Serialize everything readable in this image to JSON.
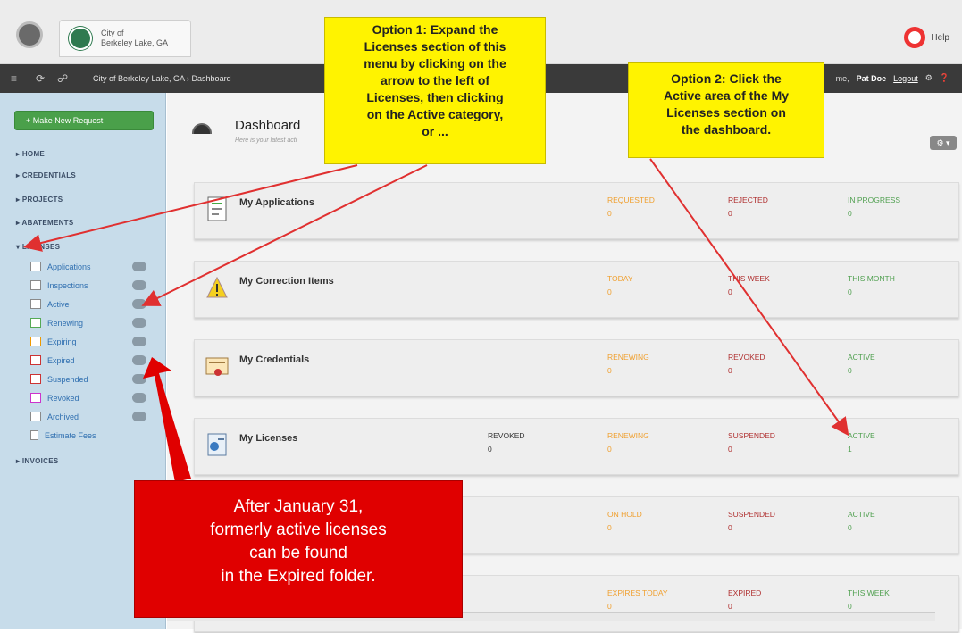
{
  "org": {
    "name_line1": "City of",
    "name_line2": "Berkeley Lake, GA"
  },
  "help_label": "Help",
  "nav": {
    "breadcrumb": "City of Berkeley Lake, GA › Dashboard",
    "welcome_user": "Pat Doe",
    "welcome_prefix": "me,",
    "logout": "Logout"
  },
  "sidebar": {
    "make_request": "+ Make New Request",
    "sections": [
      "HOME",
      "CREDENTIALS",
      "PROJECTS",
      "ABATEMENTS",
      "LICENSES",
      "INVOICES"
    ],
    "license_items": [
      "Applications",
      "Inspections",
      "Active",
      "Renewing",
      "Expiring",
      "Expired",
      "Suspended",
      "Revoked",
      "Archived",
      "Estimate Fees"
    ]
  },
  "dashboard": {
    "title": "Dashboard",
    "subtitle": "Here is your latest acti",
    "gear": "⚙ ▾",
    "cards": [
      {
        "title": "My Applications",
        "stats": [
          {
            "label": "REQUESTED",
            "value": "0",
            "color": "orange"
          },
          {
            "label": "REJECTED",
            "value": "0",
            "color": "red"
          },
          {
            "label": "IN PROGRESS",
            "value": "0",
            "color": "green"
          }
        ]
      },
      {
        "title": "My Correction Items",
        "stats": [
          {
            "label": "TODAY",
            "value": "0",
            "color": "orange"
          },
          {
            "label": "THIS WEEK",
            "value": "0",
            "color": "red"
          },
          {
            "label": "THIS MONTH",
            "value": "0",
            "color": "green"
          }
        ]
      },
      {
        "title": "My Credentials",
        "stats": [
          {
            "label": "RENEWING",
            "value": "0",
            "color": "orange"
          },
          {
            "label": "REVOKED",
            "value": "0",
            "color": "red"
          },
          {
            "label": "ACTIVE",
            "value": "0",
            "color": "green"
          }
        ]
      },
      {
        "title": "My Licenses",
        "extra": {
          "label": "REVOKED",
          "value": "0"
        },
        "stats": [
          {
            "label": "RENEWING",
            "value": "0",
            "color": "orange"
          },
          {
            "label": "SUSPENDED",
            "value": "0",
            "color": "red"
          },
          {
            "label": "ACTIVE",
            "value": "1",
            "color": "green"
          }
        ]
      },
      {
        "title": "",
        "stats": [
          {
            "label": "ON HOLD",
            "value": "0",
            "color": "orange"
          },
          {
            "label": "SUSPENDED",
            "value": "0",
            "color": "red"
          },
          {
            "label": "ACTIVE",
            "value": "0",
            "color": "green"
          }
        ]
      },
      {
        "title": "",
        "stats": [
          {
            "label": "EXPIRES TODAY",
            "value": "0",
            "color": "orange"
          },
          {
            "label": "EXPIRED",
            "value": "0",
            "color": "red"
          },
          {
            "label": "THIS WEEK",
            "value": "0",
            "color": "green"
          }
        ]
      }
    ]
  },
  "callouts": {
    "option1": [
      "Option 1: Expand the",
      "Licenses section of this",
      "menu by clicking on the",
      "arrow to the left of",
      "Licenses, then clicking",
      "on the Active category,",
      "or ..."
    ],
    "option2": [
      "Option 2: Click the",
      "Active area of the My",
      "Licenses section on",
      "the dashboard."
    ],
    "expired_note": [
      "After January 31,",
      "formerly active licenses",
      "can be found",
      "in the Expired folder."
    ]
  },
  "colors": {
    "callout_yellow": "#fff300",
    "callout_red": "#e00000",
    "arrow_red": "#e03030"
  }
}
